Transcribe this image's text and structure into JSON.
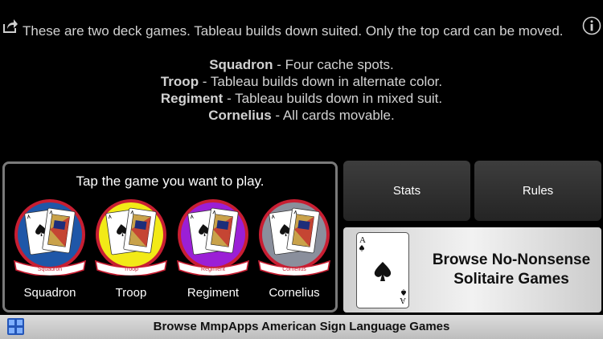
{
  "intro": "These are two deck games. Tableau builds down suited. Only the top card can be moved.",
  "variants": [
    {
      "name": "Squadron",
      "desc": " - Four cache spots."
    },
    {
      "name": "Troop",
      "desc": " - Tableau builds down in alternate color."
    },
    {
      "name": "Regiment",
      "desc": " - Tableau builds down in mixed suit."
    },
    {
      "name": "Cornelius",
      "desc": " - All cards movable."
    }
  ],
  "picker": {
    "prompt": "Tap the game you want to play.",
    "games": [
      {
        "label": "Squadron",
        "patch_text": "Squadron",
        "color": "#1f57a8"
      },
      {
        "label": "Troop",
        "patch_text": "Troop",
        "color": "#f2ea17"
      },
      {
        "label": "Regiment",
        "patch_text": "Regiment",
        "color": "#9b1fd6"
      },
      {
        "label": "Cornelius",
        "patch_text": "Cornelius",
        "color": "#8a8f9c"
      }
    ]
  },
  "buttons": {
    "stats": "Stats",
    "rules": "Rules"
  },
  "browse_solitaire": {
    "line1": "Browse No-Nonsense",
    "line2": "Solitaire Games",
    "card_rank": "A"
  },
  "browse_asl": {
    "label": "Browse MmpApps American Sign Language Games"
  },
  "colors": {
    "patch_border": "#c81e32",
    "banner_text": "#c81e32"
  }
}
